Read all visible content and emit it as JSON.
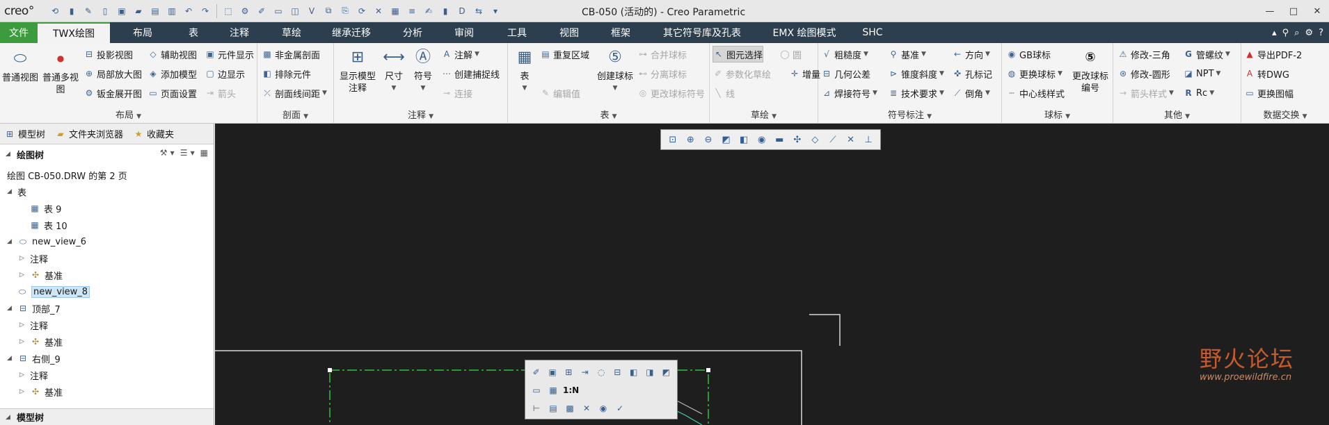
{
  "app": {
    "logo": "creo°",
    "window_title": "CB-050 (活动的) - Creo Parametric",
    "window_controls": [
      "—",
      "□",
      "✕"
    ]
  },
  "tabs": [
    {
      "label": "文件",
      "key": "file"
    },
    {
      "label": "TWX绘图",
      "key": "active"
    },
    {
      "label": "布局"
    },
    {
      "label": "表"
    },
    {
      "label": "注释"
    },
    {
      "label": "草绘"
    },
    {
      "label": "继承迁移"
    },
    {
      "label": "分析"
    },
    {
      "label": "审阅"
    },
    {
      "label": "工具"
    },
    {
      "label": "视图"
    },
    {
      "label": "框架"
    },
    {
      "label": "其它符号库及孔表"
    },
    {
      "label": "EMX 绘图模式"
    },
    {
      "label": "SHC"
    }
  ],
  "ribbon": {
    "groups": {
      "layout": "布局",
      "section": "剖面",
      "annotation": "注释",
      "table": "表",
      "sketch": "草绘",
      "symbol": "符号标注",
      "balloon": "球标",
      "other": "其他",
      "exchange": "数据交换"
    },
    "layout": {
      "general_view": "普通视图",
      "multi_view": "普通多视图",
      "projection_view": "投影视图",
      "detail_view": "局部放大图",
      "sheetmetal_flat": "钣金展开图",
      "aux_view": "辅助视图",
      "add_model": "添加模型",
      "page_setup": "页面设置",
      "component_display": "元件显示",
      "edge_display": "边显示",
      "arrow": "箭头"
    },
    "section": {
      "non_metal": "非金属剖面",
      "exclude": "排除元件",
      "line_spacing": "剖面线间距"
    },
    "annotation": {
      "show_model": "显示模型注释",
      "dimension": "尺寸",
      "symbol": "符号",
      "note": "注解",
      "snap_line": "创建捕捉线",
      "connect": "连接"
    },
    "table": {
      "table": "表",
      "repeat_region": "重复区域",
      "edit_value": "编辑值",
      "create_balloon": "创建球标",
      "merge_balloon": "合并球标",
      "split_balloon": "分离球标",
      "change_symbol": "更改球标符号"
    },
    "sketch": {
      "select": "图元选择",
      "circle": "圆",
      "param_sketch": "参数化草绘",
      "increment": "增量",
      "line": "线"
    },
    "symbol": {
      "roughness": "粗糙度",
      "datum": "基准",
      "direction": "方向",
      "gtol": "几何公差",
      "taper": "锥度斜度",
      "hole_mark": "孔标记",
      "weld": "焊接符号",
      "tech_req": "技术要求",
      "chamfer": "倒角"
    },
    "balloon": {
      "gb": "GB球标",
      "replace": "更换球标",
      "centerline": "中心线样式",
      "renumber": "更改球标编号"
    },
    "other": {
      "mod_triangle": "修改-三角",
      "mod_circle": "修改-圆形",
      "arrow_style": "箭头样式",
      "pipe_thread": "管螺纹",
      "npt": "NPT",
      "rc": "Rc"
    },
    "exchange": {
      "export_pdf": "导出PDF-2",
      "to_dwg": "转DWG",
      "replace_frame": "更换图幅"
    }
  },
  "panel": {
    "tabs": [
      "模型树",
      "文件夹浏览器",
      "收藏夹"
    ],
    "tree_title": "绘图树",
    "tree": [
      {
        "label": "绘图 CB-050.DRW 的第 2 页",
        "level": 0
      },
      {
        "label": "表",
        "level": 0
      },
      {
        "label": "表 9",
        "level": 1
      },
      {
        "label": "表 10",
        "level": 1
      },
      {
        "label": "new_view_6",
        "level": 0
      },
      {
        "label": "注释",
        "level": 1
      },
      {
        "label": "基准",
        "level": 1
      },
      {
        "label": "new_view_8",
        "level": 0
      },
      {
        "label": "顶部_7",
        "level": 0
      },
      {
        "label": "注释",
        "level": 1
      },
      {
        "label": "基准",
        "level": 1
      },
      {
        "label": "右侧_9",
        "level": 0
      },
      {
        "label": "注释",
        "level": 1
      },
      {
        "label": "基准",
        "level": 1
      }
    ],
    "footer": "模型树"
  },
  "canvas": {
    "mini_scale": "1:N",
    "watermark_cn": "野火论坛",
    "watermark_url": "www.proewildfire.cn"
  }
}
